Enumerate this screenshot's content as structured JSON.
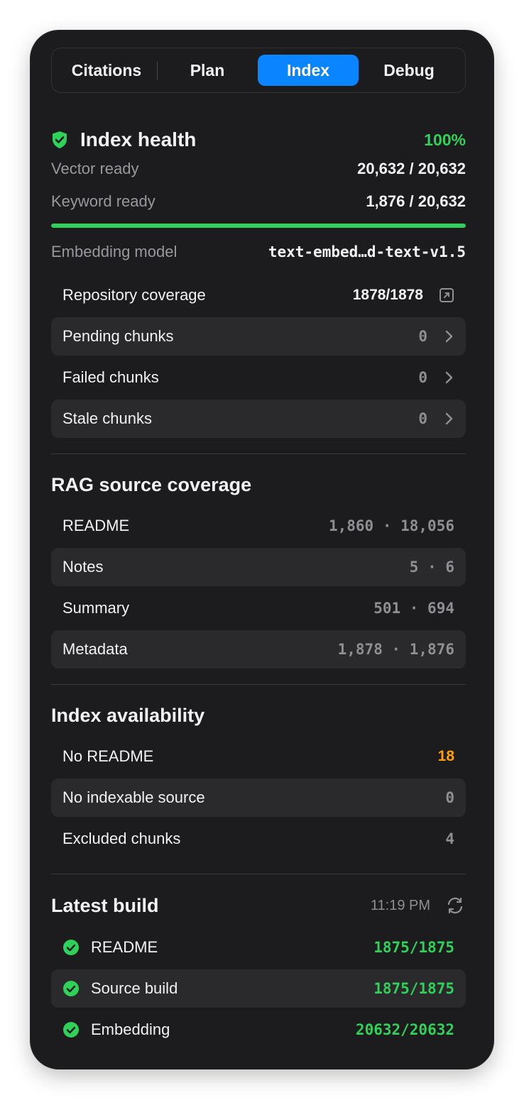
{
  "tabs": [
    {
      "label": "Citations",
      "active": false
    },
    {
      "label": "Plan",
      "active": false
    },
    {
      "label": "Index",
      "active": true
    },
    {
      "label": "Debug",
      "active": false
    }
  ],
  "health": {
    "title": "Index health",
    "percent": "100%",
    "progress": 1.0,
    "vector_label": "Vector ready",
    "vector_value": "20,632 / 20,632",
    "keyword_label": "Keyword ready",
    "keyword_value": "1,876 / 20,632",
    "embedding_label": "Embedding model",
    "embedding_value": "text-embed…d-text-v1.5"
  },
  "coverage_rows": [
    {
      "label": "Repository coverage",
      "value": "1878/1878",
      "icon": "external-link-icon"
    },
    {
      "label": "Pending chunks",
      "value": "0",
      "icon": "chevron-right-icon"
    },
    {
      "label": "Failed chunks",
      "value": "0",
      "icon": "chevron-right-icon"
    },
    {
      "label": "Stale chunks",
      "value": "0",
      "icon": "chevron-right-icon"
    }
  ],
  "rag": {
    "title": "RAG source coverage",
    "rows": [
      {
        "label": "README",
        "value": "1,860 · 18,056"
      },
      {
        "label": "Notes",
        "value": "5 · 6"
      },
      {
        "label": "Summary",
        "value": "501 · 694"
      },
      {
        "label": "Metadata",
        "value": "1,878 · 1,876"
      }
    ]
  },
  "availability": {
    "title": "Index availability",
    "rows": [
      {
        "label": "No README",
        "value": "18"
      },
      {
        "label": "No indexable source",
        "value": "0"
      },
      {
        "label": "Excluded chunks",
        "value": "4"
      }
    ]
  },
  "build": {
    "title": "Latest build",
    "time": "11:19 PM",
    "rows": [
      {
        "label": "README",
        "value": "1875/1875"
      },
      {
        "label": "Source build",
        "value": "1875/1875"
      },
      {
        "label": "Embedding",
        "value": "20632/20632"
      }
    ]
  },
  "colors": {
    "accent": "#0a84ff",
    "success": "#30d158",
    "warning": "#ff9f0a",
    "panel": "#1c1c1e"
  }
}
